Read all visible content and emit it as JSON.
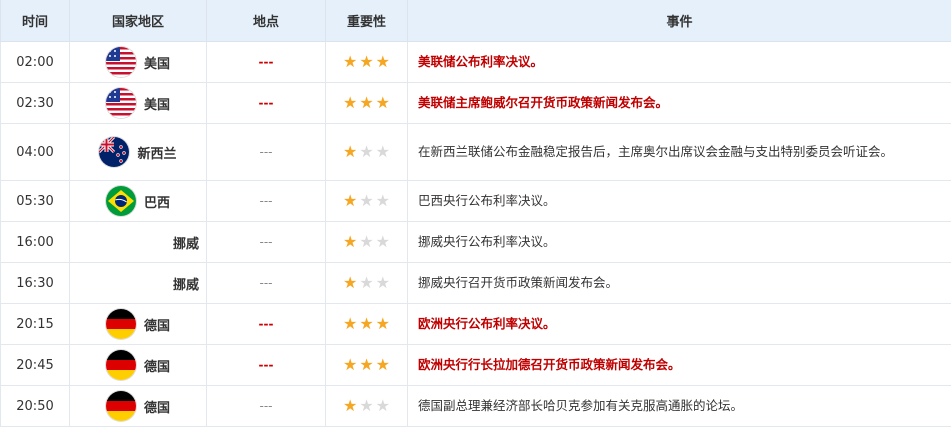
{
  "headers": [
    "时间",
    "国家地区",
    "地点",
    "重要性",
    "事件"
  ],
  "colors": {
    "important": "#c00000",
    "star_on": "#f5a623",
    "star_off": "#d9d9d9",
    "header_bg": "#e6f0fb"
  },
  "rows": [
    {
      "time": "02:00",
      "country": "美国",
      "flag": "us-flag-icon",
      "location": "---",
      "stars": 3,
      "event": "美联储公布利率决议。",
      "important": true
    },
    {
      "time": "02:30",
      "country": "美国",
      "flag": "us-flag-icon",
      "location": "---",
      "stars": 3,
      "event": "美联储主席鲍威尔召开货币政策新闻发布会。",
      "important": true
    },
    {
      "time": "04:00",
      "country": "新西兰",
      "flag": "nz-flag-icon",
      "location": "---",
      "stars": 1,
      "event": "在新西兰联储公布金融稳定报告后，主席奥尔出席议会金融与支出特别委员会听证会。",
      "important": false
    },
    {
      "time": "05:30",
      "country": "巴西",
      "flag": "br-flag-icon",
      "location": "---",
      "stars": 1,
      "event": "巴西央行公布利率决议。",
      "important": false
    },
    {
      "time": "16:00",
      "country": "挪威",
      "flag": "",
      "location": "---",
      "stars": 1,
      "event": "挪威央行公布利率决议。",
      "important": false
    },
    {
      "time": "16:30",
      "country": "挪威",
      "flag": "",
      "location": "---",
      "stars": 1,
      "event": "挪威央行召开货币政策新闻发布会。",
      "important": false
    },
    {
      "time": "20:15",
      "country": "德国",
      "flag": "de-flag-icon",
      "location": "---",
      "stars": 3,
      "event": "欧洲央行公布利率决议。",
      "important": true
    },
    {
      "time": "20:45",
      "country": "德国",
      "flag": "de-flag-icon",
      "location": "---",
      "stars": 3,
      "event": "欧洲央行行长拉加德召开货币政策新闻发布会。",
      "important": true
    },
    {
      "time": "20:50",
      "country": "德国",
      "flag": "de-flag-icon",
      "location": "---",
      "stars": 1,
      "event": "德国副总理兼经济部长哈贝克参加有关克服高通胀的论坛。",
      "important": false
    }
  ]
}
